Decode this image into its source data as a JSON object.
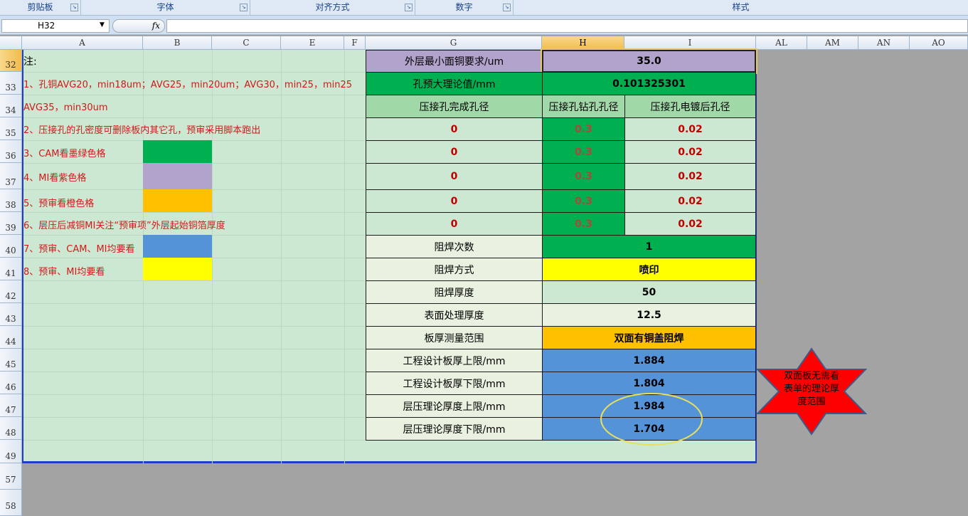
{
  "ribbon": {
    "groups": [
      "剪贴板",
      "字体",
      "对齐方式",
      "数字",
      "样式"
    ]
  },
  "formula_bar": {
    "name_box": "H32",
    "fx_label": "fx",
    "formula": ""
  },
  "columns": [
    "A",
    "B",
    "C",
    "E",
    "F",
    "G",
    "H",
    "I",
    "AL",
    "AM",
    "AN",
    "AO"
  ],
  "rows": [
    "32",
    "33",
    "34",
    "35",
    "36",
    "37",
    "38",
    "39",
    "40",
    "41",
    "42",
    "43",
    "44",
    "45",
    "46",
    "47",
    "48",
    "49",
    "57",
    "58"
  ],
  "notes": {
    "heading": "注:",
    "items": [
      "1、孔铜AVG20，min18um；AVG25，min20um；AVG30，min25，min25",
      "AVG35，min30um",
      "2、压接孔的孔密度可删除板内其它孔，预审采用脚本跑出",
      "3、CAM看墨绿色格",
      "4、MI看紫色格",
      "5、预审看橙色格",
      "6、层压后减铜MI关注“预审项”外层起始铜箔厚度",
      "7、预审、CAM、MI均要看",
      "8、预审、MI均要看"
    ],
    "swatch_colors": [
      "#00b050",
      "#b1a3cc",
      "#ffc000",
      "#5593d9",
      "#ffff00"
    ]
  },
  "table": {
    "outer_copper_label": "外层最小面铜要求/um",
    "outer_copper_value": "35.0",
    "hole_enlarge_label": "孔预大理论值/mm",
    "hole_enlarge_value": "0.101325301",
    "press_fit_headers": [
      "压接孔完成孔径",
      "压接孔钻孔孔径",
      "压接孔电镀后孔径"
    ],
    "press_fit_rows": [
      [
        "0",
        "0.3",
        "0.02"
      ],
      [
        "0",
        "0.3",
        "0.02"
      ],
      [
        "0",
        "0.3",
        "0.02"
      ],
      [
        "0",
        "0.3",
        "0.02"
      ],
      [
        "0",
        "0.3",
        "0.02"
      ]
    ],
    "params": [
      {
        "label": "阻焊次数",
        "value": "1"
      },
      {
        "label": "阻焊方式",
        "value": "喷印"
      },
      {
        "label": "阻焊厚度",
        "value": "50"
      },
      {
        "label": "表面处理厚度",
        "value": "12.5"
      },
      {
        "label": "板厚测量范围",
        "value": "双面有铜盖阻焊"
      },
      {
        "label": "工程设计板厚上限/mm",
        "value": "1.884"
      },
      {
        "label": "工程设计板厚下限/mm",
        "value": "1.804"
      },
      {
        "label": "层压理论厚度上限/mm",
        "value": "1.984"
      },
      {
        "label": "层压理论厚度下限/mm",
        "value": "1.704"
      }
    ]
  },
  "annotation": {
    "star_text": "双面板无需看表单的理论厚度范围",
    "star_color": "#ff0000",
    "ellipse_color": "#e8e05a"
  },
  "colors": {
    "green": "#00b050",
    "purple": "#b1a3cc",
    "orange": "#ffc000",
    "blue": "#5593d9",
    "yellow": "#ffff00",
    "sheet": "#cde8d2"
  }
}
